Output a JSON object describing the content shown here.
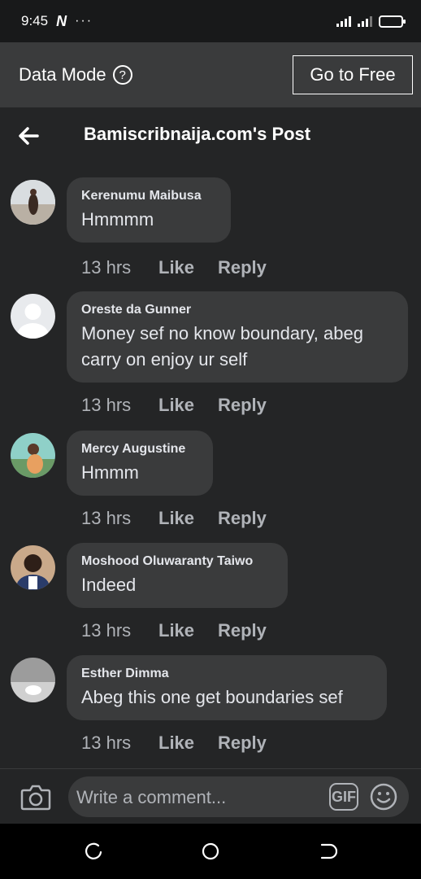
{
  "status_bar": {
    "time": "9:45",
    "carrier_icon": "N",
    "more": "···"
  },
  "data_mode": {
    "label": "Data Mode",
    "help": "?",
    "go_free_label": "Go to Free"
  },
  "header": {
    "title": "Bamiscribnaija.com's Post"
  },
  "comments": [
    {
      "author": "Kerenumu Maibusa",
      "text": "Hmmmm",
      "time": "13 hrs",
      "like": "Like",
      "reply": "Reply"
    },
    {
      "author": "Oreste da Gunner",
      "text": "Money sef no know boundary, abeg carry on enjoy ur self",
      "time": "13 hrs",
      "like": "Like",
      "reply": "Reply"
    },
    {
      "author": "Mercy Augustine",
      "text": "Hmmm",
      "time": "13 hrs",
      "like": "Like",
      "reply": "Reply"
    },
    {
      "author": "Moshood Oluwaranty Taiwo",
      "text": "Indeed",
      "time": "13 hrs",
      "like": "Like",
      "reply": "Reply"
    },
    {
      "author": "Esther Dimma",
      "text": "Abeg this one get boundaries sef",
      "time": "13 hrs",
      "like": "Like",
      "reply": "Reply"
    }
  ],
  "composer": {
    "placeholder": "Write a comment...",
    "gif_label": "GIF"
  },
  "colors": {
    "background": "#242526",
    "bubble": "#3a3b3c",
    "secondary_text": "#b0b3b8",
    "primary_text": "#e4e6eb"
  }
}
